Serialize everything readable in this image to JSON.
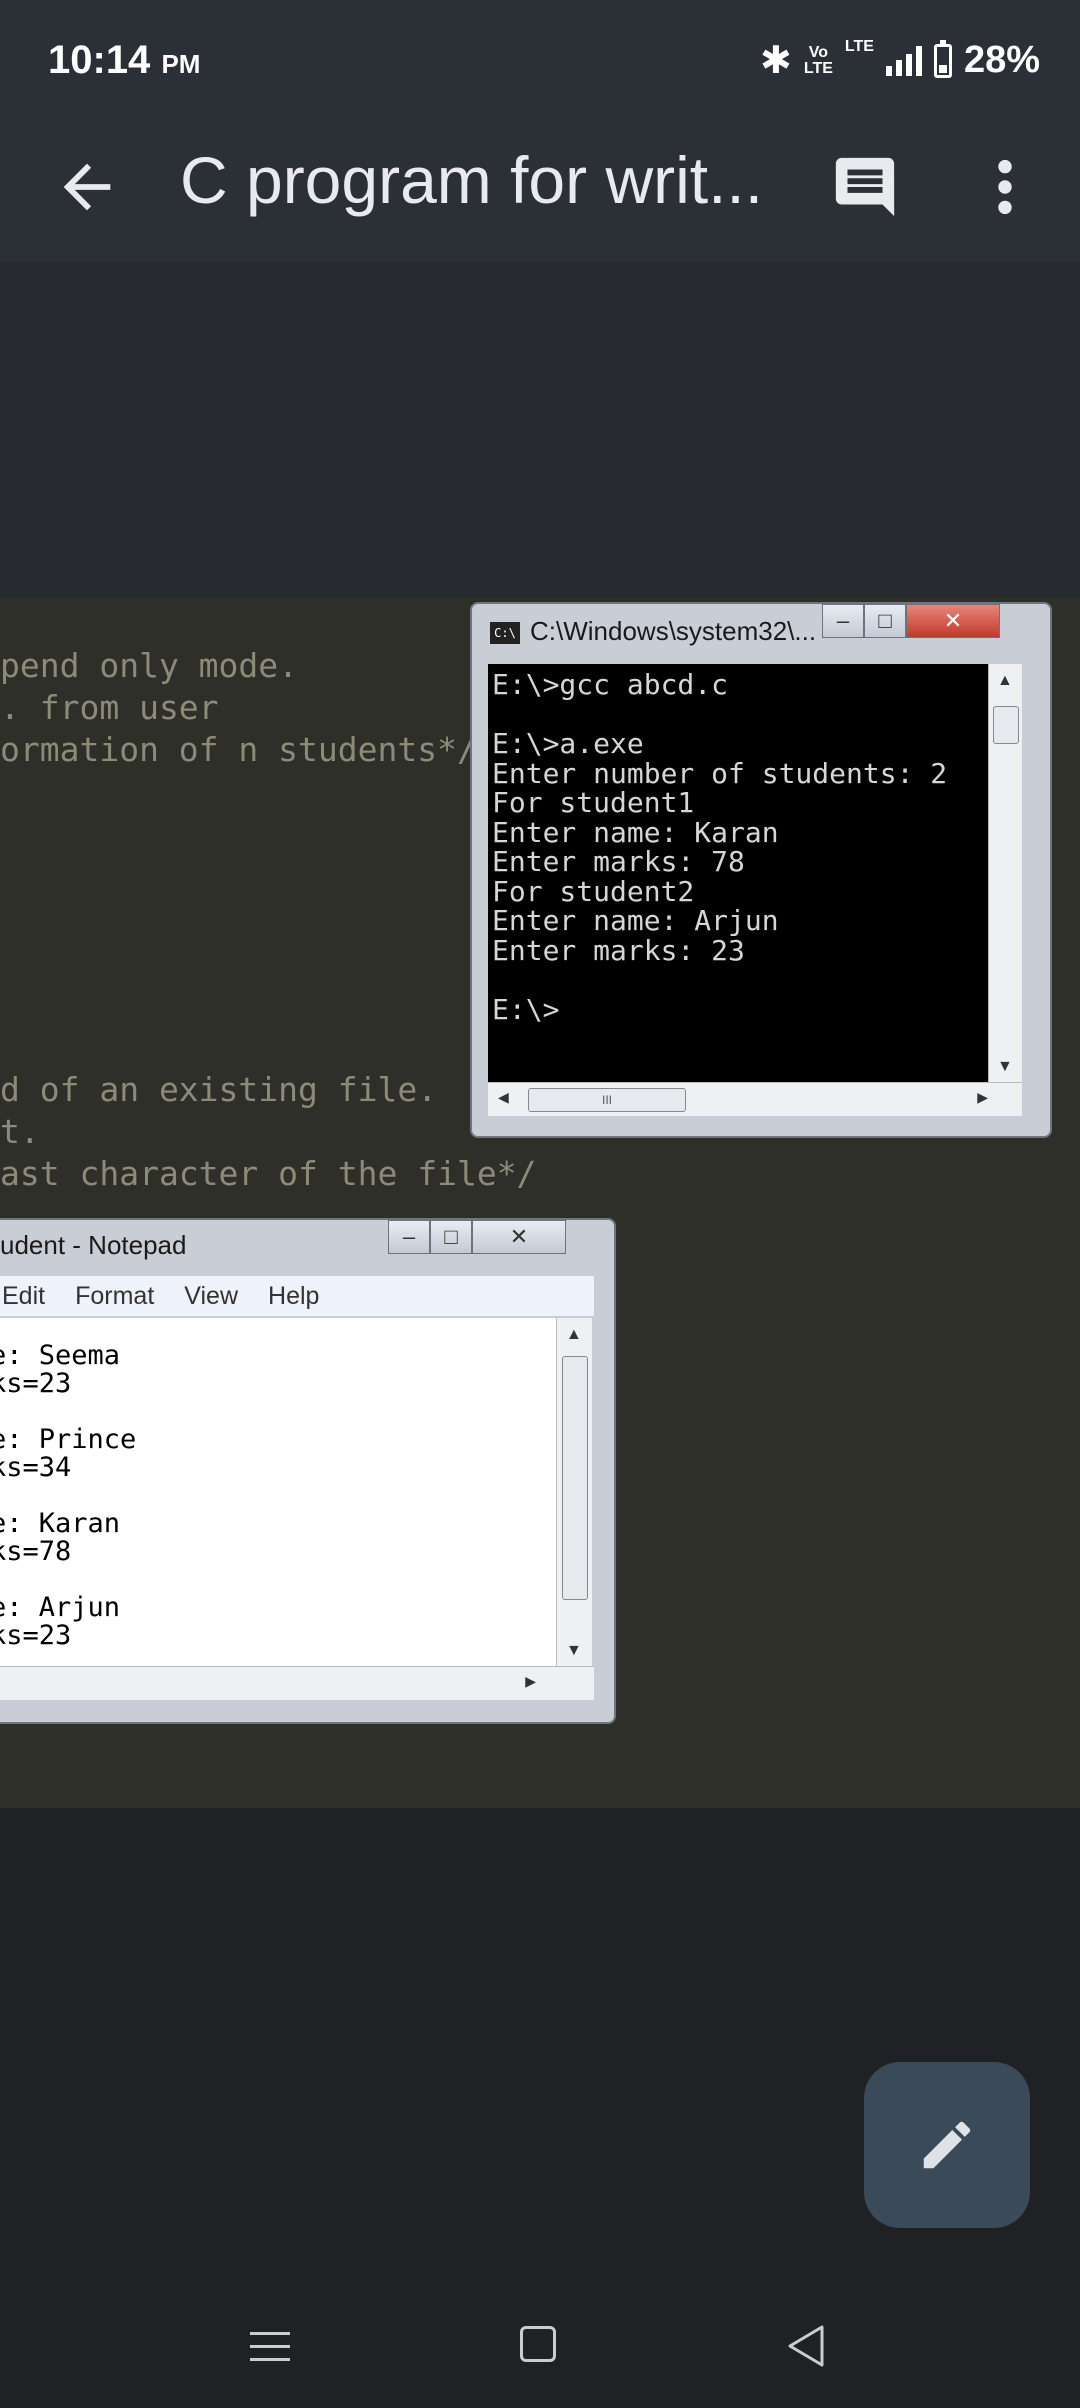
{
  "status_bar": {
    "time": "10:14",
    "ampm": "PM",
    "volte_line1": "Vo",
    "volte_line2": "LTE",
    "lte": "LTE",
    "battery_percent": "28%",
    "battery_level": 0.28,
    "icons": [
      "bluetooth-icon",
      "signal-icon",
      "battery-icon"
    ]
  },
  "app_bar": {
    "title": "C program for writ...",
    "icons": [
      "back-arrow-icon",
      "comment-icon",
      "more-vert-icon"
    ]
  },
  "code_lines": [
    "pend only mode.",
    ". from user",
    "ormation of n students*/",
    "d of an existing file.",
    "t.",
    "ast character of the file*/"
  ],
  "cmd_window": {
    "title": "C:\\Windows\\system32\\...",
    "icon_label": "C:\\",
    "output": "E:\\>gcc abcd.c\n\nE:\\>a.exe\nEnter number of students: 2\nFor student1\nEnter name: Karan\nEnter marks: 78\nFor student2\nEnter name: Arjun\nEnter marks: 23\n\nE:\\>"
  },
  "notepad_window": {
    "title": "udent - Notepad",
    "menu": [
      "Edit",
      "Format",
      "View",
      "Help"
    ],
    "text": "e: Seema\nks=23\n\ne: Prince\nks=34\n\ne: Karan\nks=78\n\ne: Arjun\nks=23"
  },
  "fab": {
    "icon": "pencil-icon"
  },
  "nav_bar": {
    "icons": [
      "recent-apps-icon",
      "home-icon",
      "back-triangle-icon"
    ]
  }
}
